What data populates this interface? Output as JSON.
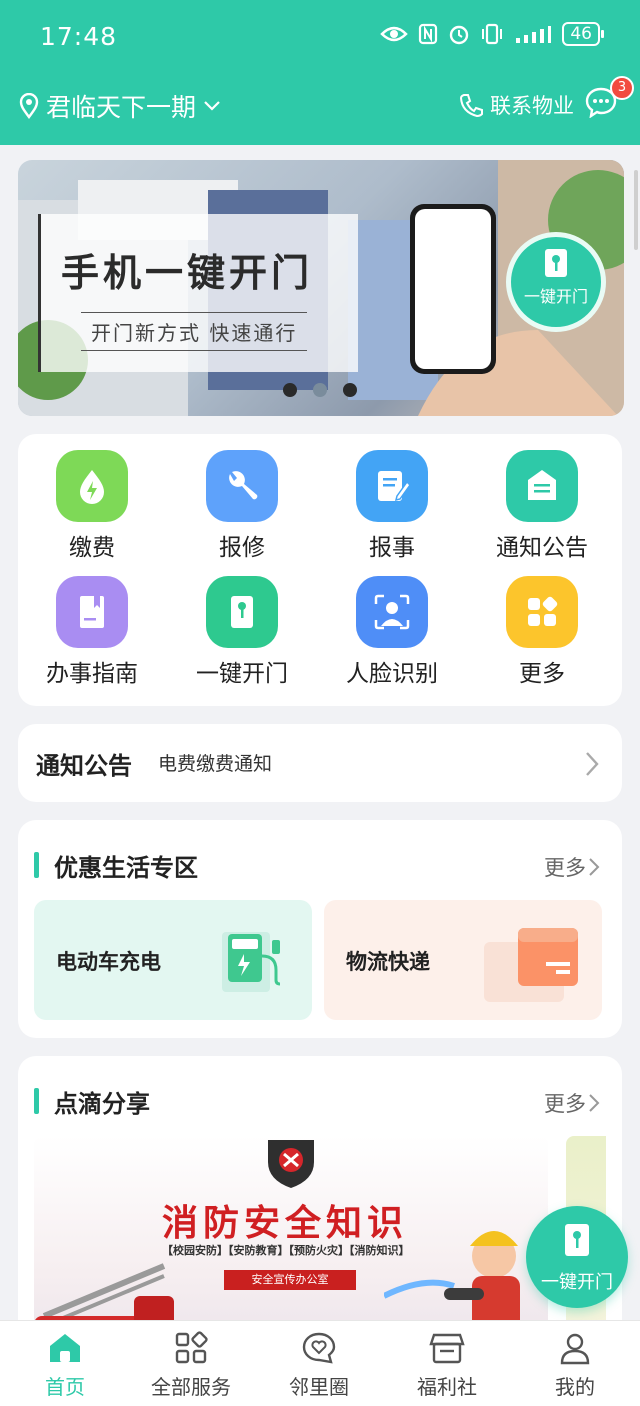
{
  "status_bar": {
    "time": "17:48",
    "battery": "46"
  },
  "header": {
    "location": "君临天下一期",
    "contact": "联系物业",
    "message_count": "3"
  },
  "banner": {
    "title": "手机一键开门",
    "subtitle": "开门新方式 快速通行",
    "button": "一键开门"
  },
  "services": [
    {
      "label": "缴费",
      "icon": "water-drop-icon",
      "color": "#7ed957"
    },
    {
      "label": "报修",
      "icon": "wrench-icon",
      "color": "#5ea2fb"
    },
    {
      "label": "报事",
      "icon": "document-edit-icon",
      "color": "#43a4f5"
    },
    {
      "label": "通知公告",
      "icon": "notice-board-icon",
      "color": "#2ec9a8"
    },
    {
      "label": "办事指南",
      "icon": "book-icon",
      "color": "#a98df2"
    },
    {
      "label": "一键开门",
      "icon": "key-card-icon",
      "color": "#2ec98f"
    },
    {
      "label": "人脸识别",
      "icon": "face-scan-icon",
      "color": "#4f8ef7"
    },
    {
      "label": "更多",
      "icon": "grid-more-icon",
      "color": "#fcc52c"
    }
  ],
  "notice": {
    "title": "通知公告",
    "text": "电费缴费通知"
  },
  "life_section": {
    "title": "优惠生活专区",
    "more": "更多",
    "tiles": [
      {
        "label": "电动车充电",
        "bg": "#e3f7f1",
        "icon": "charging-station-icon"
      },
      {
        "label": "物流快递",
        "bg": "#fdf0ea",
        "icon": "package-box-icon"
      }
    ]
  },
  "share_section": {
    "title": "点滴分享",
    "more": "更多",
    "poster": {
      "title": "消防安全知识",
      "tags": "【校园安防】【安防教育】【预防火灾】【消防知识】",
      "ribbon": "安全宣传办公室"
    }
  },
  "fab": {
    "label": "一键开门"
  },
  "tabbar": [
    {
      "label": "首页",
      "icon": "home-icon",
      "active": true
    },
    {
      "label": "全部服务",
      "icon": "services-grid-icon",
      "active": false
    },
    {
      "label": "邻里圈",
      "icon": "neighborhood-heart-icon",
      "active": false
    },
    {
      "label": "福利社",
      "icon": "shop-icon",
      "active": false
    },
    {
      "label": "我的",
      "icon": "profile-icon",
      "active": false
    }
  ]
}
